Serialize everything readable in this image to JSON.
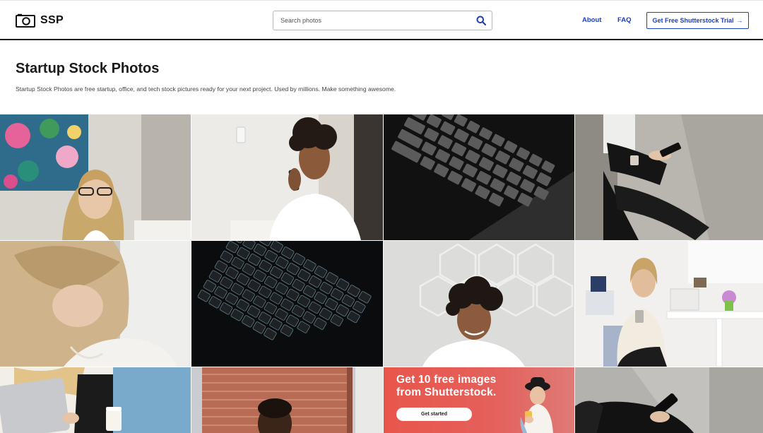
{
  "header": {
    "logo_text": "SSP",
    "logo_icon": "camera-icon",
    "search_placeholder": "Search photos",
    "search_icon": "search-icon",
    "nav": {
      "about": "About",
      "faq": "FAQ"
    },
    "cta_label": "Get Free Shutterstock Trial",
    "cta_arrow": "→",
    "accent_color": "#1d3fc4"
  },
  "hero": {
    "title": "Startup Stock Photos",
    "subtitle": "Startup Stock Photos are free startup, office, and tech stock pictures ready for your next project. Used by millions. Make something awesome."
  },
  "photos": [
    {
      "subject": "woman with glasses smiling in office"
    },
    {
      "subject": "woman talking on phone"
    },
    {
      "subject": "keyboard close-up"
    },
    {
      "subject": "person using smartphone seated"
    },
    {
      "subject": "woman looking down at desk"
    },
    {
      "subject": "backlit dark keyboard"
    },
    {
      "subject": "woman smiling at laptop"
    },
    {
      "subject": "woman in office using phone"
    },
    {
      "subject": "woman holding laptop with coffee"
    },
    {
      "subject": "man by brick wall"
    },
    {
      "subject": "promo"
    },
    {
      "subject": "person holding smartphone"
    }
  ],
  "promo": {
    "headline_line1": "Get 10 free images",
    "headline_line2": "from Shutterstock.",
    "button_label": "Get started",
    "background_color": "#e8564b"
  }
}
